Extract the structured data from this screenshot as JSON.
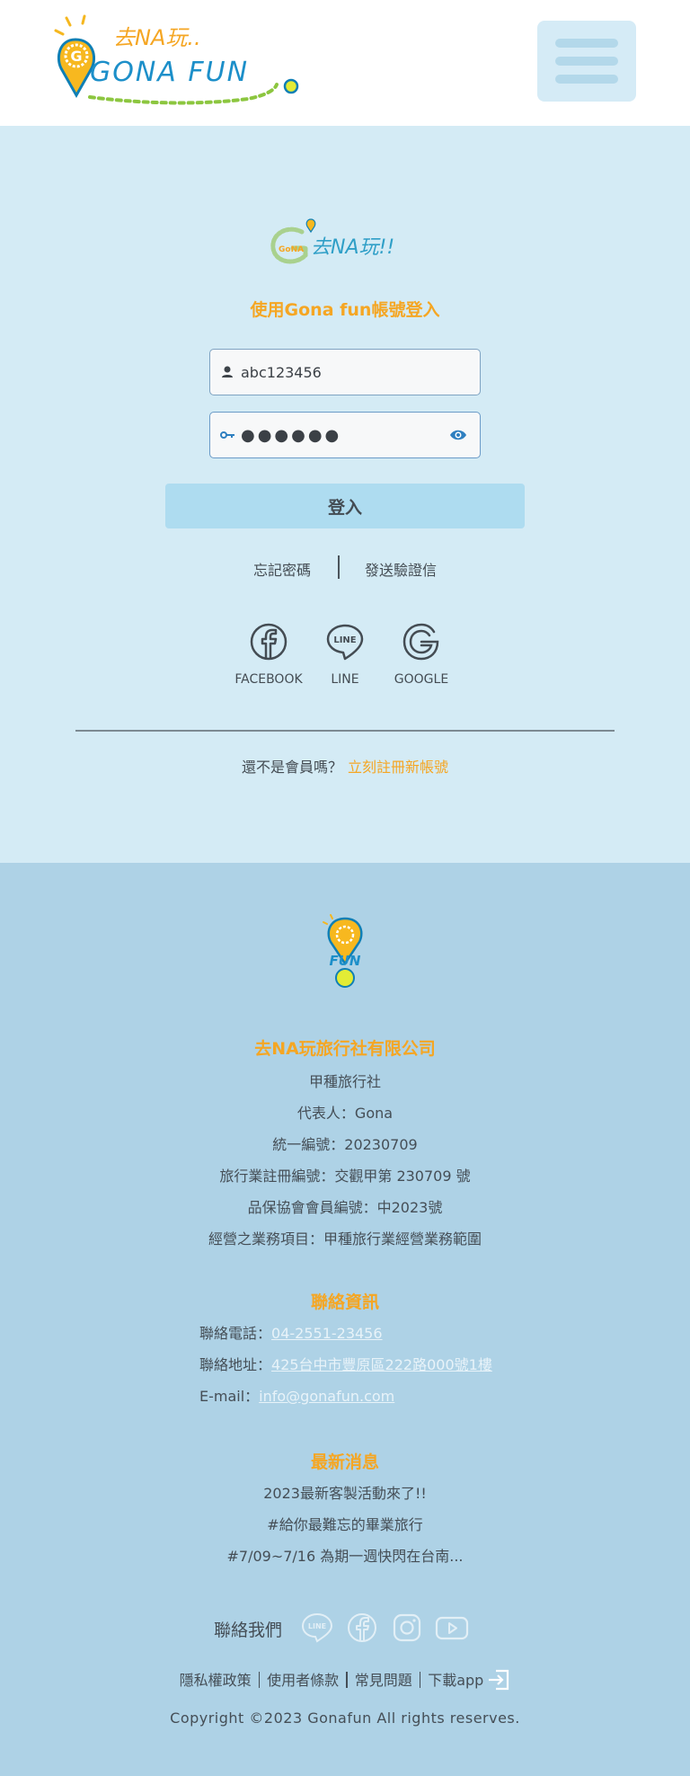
{
  "header": {
    "logo_top_text": "去NA玩..",
    "logo_main_text": "GONA FUN",
    "logo_badge": "G"
  },
  "login": {
    "mini_logo_text": "去NA玩!!",
    "mini_logo_badge": "GoNA",
    "title": "使用Gona fun帳號登入",
    "username_value": "abc123456",
    "password_value": "●●●●●●",
    "submit_label": "登入",
    "forgot_label": "忘記密碼",
    "verify_label": "發送驗證信",
    "social": [
      {
        "label": "FACEBOOK",
        "icon": "facebook-icon"
      },
      {
        "label": "LINE",
        "icon": "line-icon"
      },
      {
        "label": "GOOGLE",
        "icon": "google-icon"
      }
    ],
    "line_glyph": "LINE",
    "signup_prompt": "還不是會員嗎？",
    "signup_cta": "立刻註冊新帳號"
  },
  "footer": {
    "logo_text": "FUN",
    "company_name": "去NA玩旅行社有限公司",
    "company_lines": [
      "甲種旅行社",
      "代表人：Gona",
      "統一編號：20230709",
      "旅行業註冊編號：交觀甲第 230709 號",
      "品保協會會員編號：中2023號",
      "經營之業務項目：甲種旅行業經營業務範圍"
    ],
    "contact_title": "聯絡資訊",
    "contact": {
      "phone_label": "聯絡電話：",
      "phone": "04-2551-23456",
      "address_label": "聯絡地址：",
      "address": "425台中市豐原區222路000號1樓",
      "email_label": "E-mail：",
      "email": "info@gonafun.com"
    },
    "news_title": "最新消息",
    "news": [
      "2023最新客製活動來了!!",
      "#給你最難忘的畢業旅行",
      "#7/09~7/16 為期一週快閃在台南..."
    ],
    "contact_us_label": "聯絡我們",
    "line_glyph": "LINE",
    "nav": {
      "privacy": "隱私權政策",
      "terms": "使用者條款",
      "faq": "常見問題",
      "download": "下載app"
    },
    "copyright": "Copyright ©2023 Gonafun All rights reserves."
  },
  "colors": {
    "accent_orange": "#f5a623",
    "brand_blue": "#1c8fc9",
    "login_bg": "#d4ebf5",
    "footer_bg": "#aed2e6",
    "button_bg": "#aedcf0"
  }
}
